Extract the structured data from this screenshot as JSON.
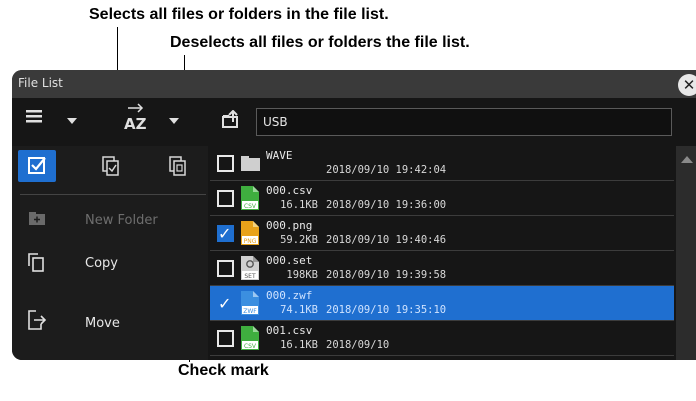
{
  "annotations": {
    "select_all": "Selects all files or folders in the file list.",
    "deselect_all": "Deselects all files or folders the file list.",
    "check_mark": "Check mark"
  },
  "window": {
    "title": "File List",
    "close_icon": "close-icon"
  },
  "toolbar": {
    "view_icon": "list-view-icon",
    "sort_label": "A→Z",
    "path_icon": "up-folder-icon",
    "path": "USB"
  },
  "left_menu": {
    "select_mode_icon": "checkbox-mode-icon",
    "select_all_icon": "select-all-icon",
    "deselect_all_icon": "deselect-all-icon",
    "items": [
      {
        "label": "New Folder",
        "icon": "new-folder-icon",
        "enabled": false
      },
      {
        "label": "Copy",
        "icon": "copy-icon",
        "enabled": true
      },
      {
        "label": "Move",
        "icon": "move-icon",
        "enabled": true
      }
    ]
  },
  "files": [
    {
      "name": "WAVE",
      "size": "",
      "date": "2018/09/10 19:42:04",
      "type": "folder",
      "checked": false,
      "selected": false
    },
    {
      "name": "000.csv",
      "size": "16.1KB",
      "date": "2018/09/10 19:36:00",
      "type": "CSV",
      "checked": false,
      "selected": false
    },
    {
      "name": "000.png",
      "size": "59.2KB",
      "date": "2018/09/10 19:40:46",
      "type": "PNG",
      "checked": true,
      "selected": false
    },
    {
      "name": "000.set",
      "size": "198KB",
      "date": "2018/09/10 19:39:58",
      "type": "SET",
      "checked": false,
      "selected": false
    },
    {
      "name": "000.zwf",
      "size": "74.1KB",
      "date": "2018/09/10 19:35:10",
      "type": "ZWF",
      "checked": true,
      "selected": true
    },
    {
      "name": "001.csv",
      "size": "16.1KB",
      "date": "2018/09/10",
      "type": "CSV",
      "checked": false,
      "selected": false
    }
  ],
  "colors": {
    "accent": "#1f6fd0",
    "csv": "#3fae3f",
    "png": "#e8a21a",
    "zwf": "#3b8fe0",
    "set": "#cfcfcf"
  }
}
